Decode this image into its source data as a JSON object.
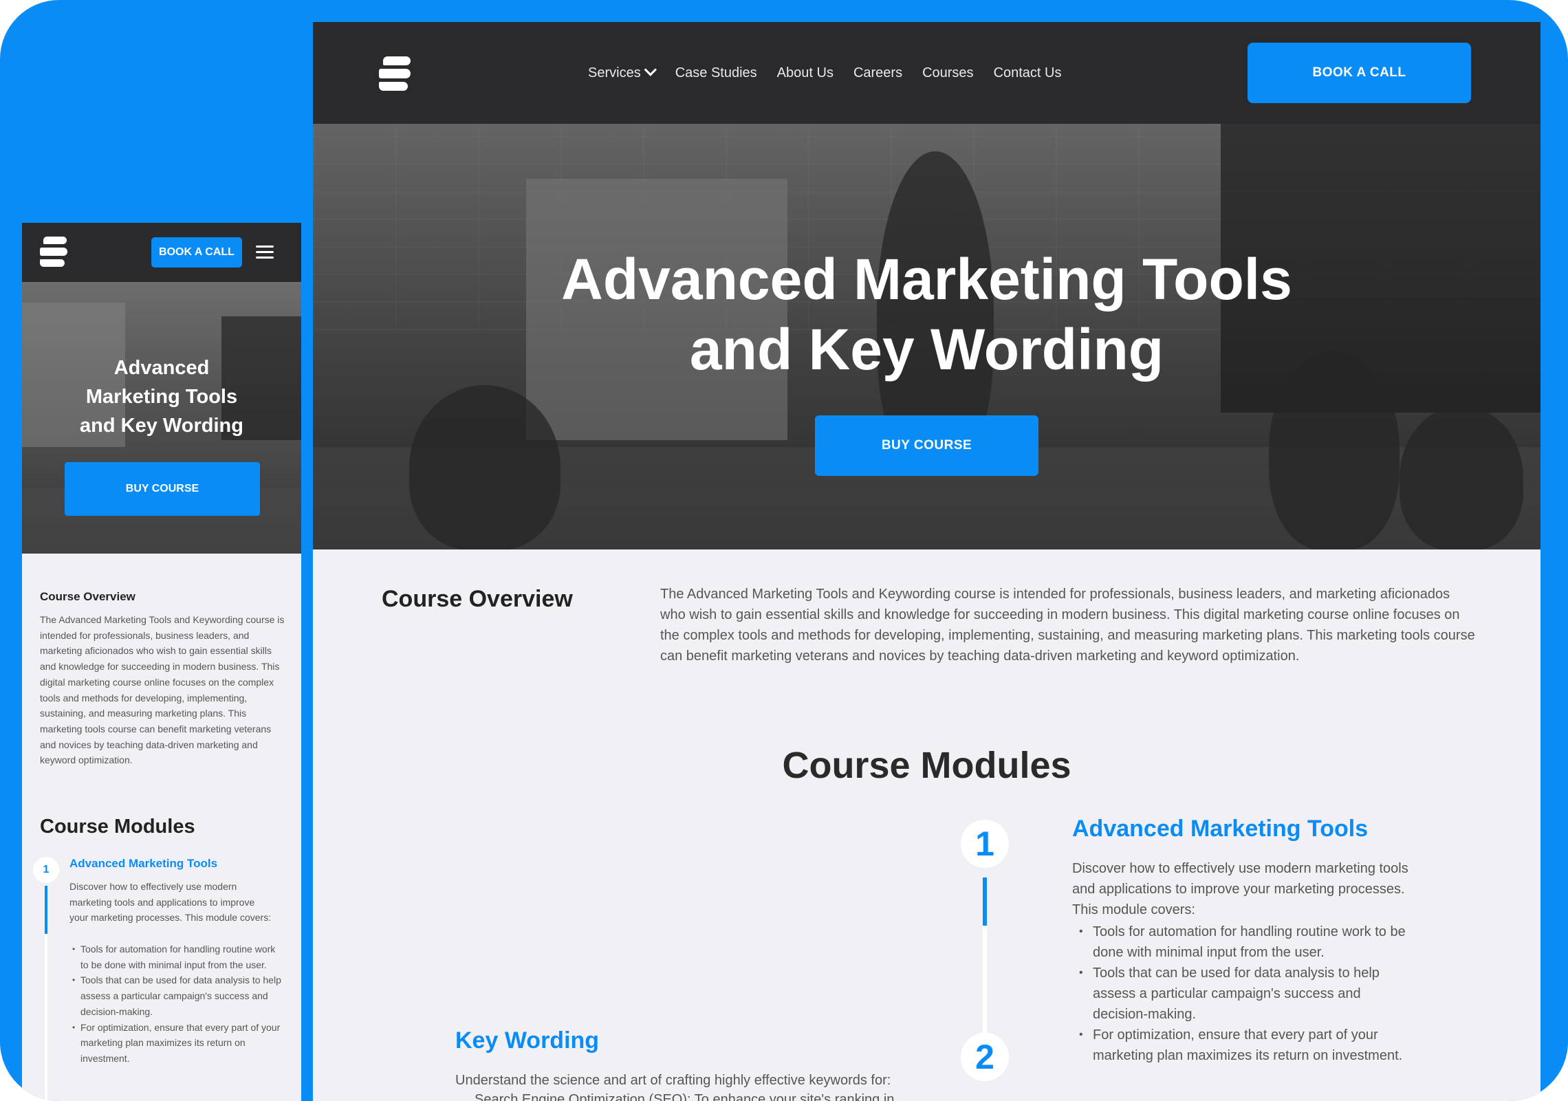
{
  "colors": {
    "accent": "#0a8cf7",
    "nav_bg": "#2a2a2c",
    "page_bg": "#f1f1f5",
    "frame_bg": "#0a8cf7"
  },
  "icons": {
    "logo": "stacked-s-logo",
    "menu": "hamburger-icon",
    "dropdown": "chevron-down-icon"
  },
  "desktop": {
    "nav": {
      "items": [
        {
          "label": "Services",
          "has_dropdown": true
        },
        {
          "label": "Case Studies"
        },
        {
          "label": "About Us"
        },
        {
          "label": "Careers"
        },
        {
          "label": "Courses"
        },
        {
          "label": "Contact Us"
        }
      ],
      "cta": "BOOK A CALL"
    },
    "hero": {
      "title_line1": "Advanced Marketing Tools",
      "title_line2": "and Key Wording",
      "cta": "BUY COURSE"
    },
    "overview": {
      "heading": "Course Overview",
      "text": "The Advanced Marketing Tools and Keywording course is intended for professionals, business leaders, and marketing aficionados who wish to gain essential skills and knowledge for succeeding in modern business. This digital marketing course online focuses on the complex tools and methods for developing, implementing, sustaining, and measuring marketing plans. This marketing tools course can benefit marketing veterans and novices by teaching data-driven marketing and keyword optimization."
    },
    "modules": {
      "heading": "Course Modules",
      "items": [
        {
          "number": "1",
          "title": "Advanced Marketing Tools",
          "description": "Discover how to effectively use modern marketing tools and applications to improve your marketing processes. This module covers:",
          "bullets": [
            "Tools for automation for handling routine work to be done with minimal input from the user.",
            "Tools that can be used for data analysis to help assess a particular campaign's success and decision-making.",
            "For optimization, ensure that every part of your marketing plan maximizes its return on investment."
          ]
        },
        {
          "number": "2",
          "title": "Key Wording",
          "description": "Understand the science and art of crafting highly effective keywords for:",
          "bullets_partial": "Search Engine Optimization (SEO): To enhance your site's ranking in"
        }
      ]
    }
  },
  "mobile": {
    "nav": {
      "cta": "BOOK A CALL"
    },
    "hero": {
      "title_line1": "Advanced",
      "title_line2": "Marketing Tools",
      "title_line3": "and Key Wording",
      "cta": "BUY COURSE"
    },
    "overview": {
      "heading": "Course Overview",
      "text": "The Advanced Marketing Tools and Keywording course is intended for professionals, business leaders, and marketing aficionados who wish to gain essential skills and knowledge for succeeding in modern business. This digital marketing course online focuses on the complex tools and methods for developing, implementing, sustaining, and measuring marketing plans. This marketing tools course can benefit marketing veterans and novices by teaching data-driven marketing and keyword optimization."
    },
    "modules": {
      "heading": "Course Modules",
      "items": [
        {
          "number": "1",
          "title": "Advanced Marketing Tools",
          "description": "Discover how to effectively use modern marketing tools and applications to improve your marketing processes. This module covers:",
          "bullets": [
            "Tools for automation for handling routine work to be done with minimal input from the user.",
            "Tools that can be used for data analysis to help assess a particular campaign's success and decision-making.",
            "For optimization, ensure that every part of your marketing plan maximizes its return on investment."
          ]
        }
      ]
    }
  }
}
